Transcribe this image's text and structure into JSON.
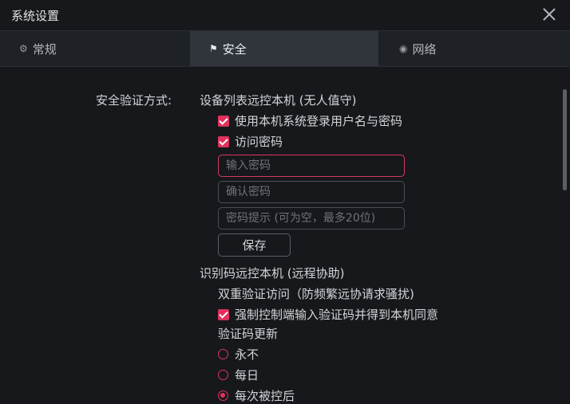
{
  "window": {
    "title": "系统设置"
  },
  "tabs": [
    {
      "label": "常规",
      "icon": "gear-icon"
    },
    {
      "label": "安全",
      "icon": "shield-icon"
    },
    {
      "label": "网络",
      "icon": "globe-icon"
    }
  ],
  "security": {
    "section_label": "安全验证方式:",
    "device_list": {
      "title": "设备列表远控本机 (无人值守)",
      "use_system_login": "使用本机系统登录用户名与密码",
      "access_password": "访问密码",
      "input_password_placeholder": "输入密码",
      "confirm_password_placeholder": "确认密码",
      "password_hint_placeholder": "密码提示 (可为空，最多20位)",
      "save_label": "保存"
    },
    "id_code": {
      "title": "识别码远控本机 (远程协助)",
      "two_factor": "双重验证访问（防频繁远协请求骚扰)",
      "force_code": "强制控制端输入验证码并得到本机同意",
      "update_title": "验证码更新",
      "options": [
        "永不",
        "每日",
        "每次被控后"
      ],
      "selected_index": 2
    }
  },
  "colors": {
    "accent": "#e0325c",
    "background": "#16181c",
    "tab_bar": "#1e2126",
    "active_tab": "#30343b"
  }
}
